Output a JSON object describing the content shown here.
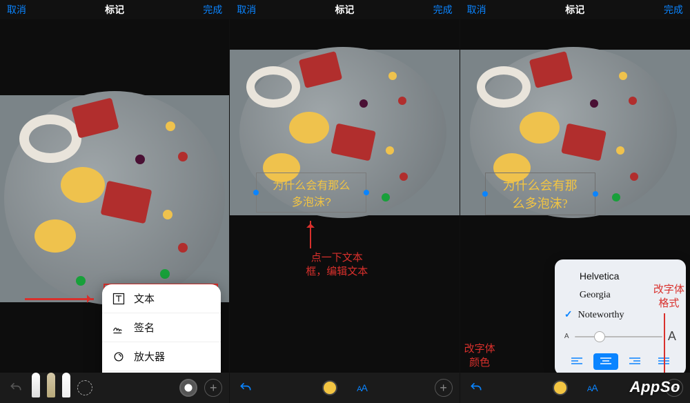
{
  "nav": {
    "cancel": "取消",
    "title": "标记",
    "done": "完成"
  },
  "popup": {
    "text": "文本",
    "signature": "签名",
    "magnifier": "放大器"
  },
  "textbox": {
    "line1": "为什么会有那么",
    "line2": "多泡沫?",
    "line1b": "为什么会有那",
    "line2b": "么多泡沫?"
  },
  "annotations": {
    "tapEdit": "点一下文本\n框，编辑文本",
    "changeColor": "改字体\n颜色",
    "changeFormat": "改字体\n格式"
  },
  "fontpanel": {
    "opts": [
      "Helvetica",
      "Georgia",
      "Noteworthy"
    ],
    "selected": 2,
    "sizeSmall": "A",
    "sizeLarge": "A",
    "align": [
      "left",
      "center",
      "right",
      "justify"
    ],
    "alignSelected": 1
  },
  "toolbar": {
    "aaLabel": "AA"
  },
  "colors": {
    "accent": "#0a84ff",
    "swatchYellow": "#f3c542"
  },
  "watermark": "AppSo"
}
